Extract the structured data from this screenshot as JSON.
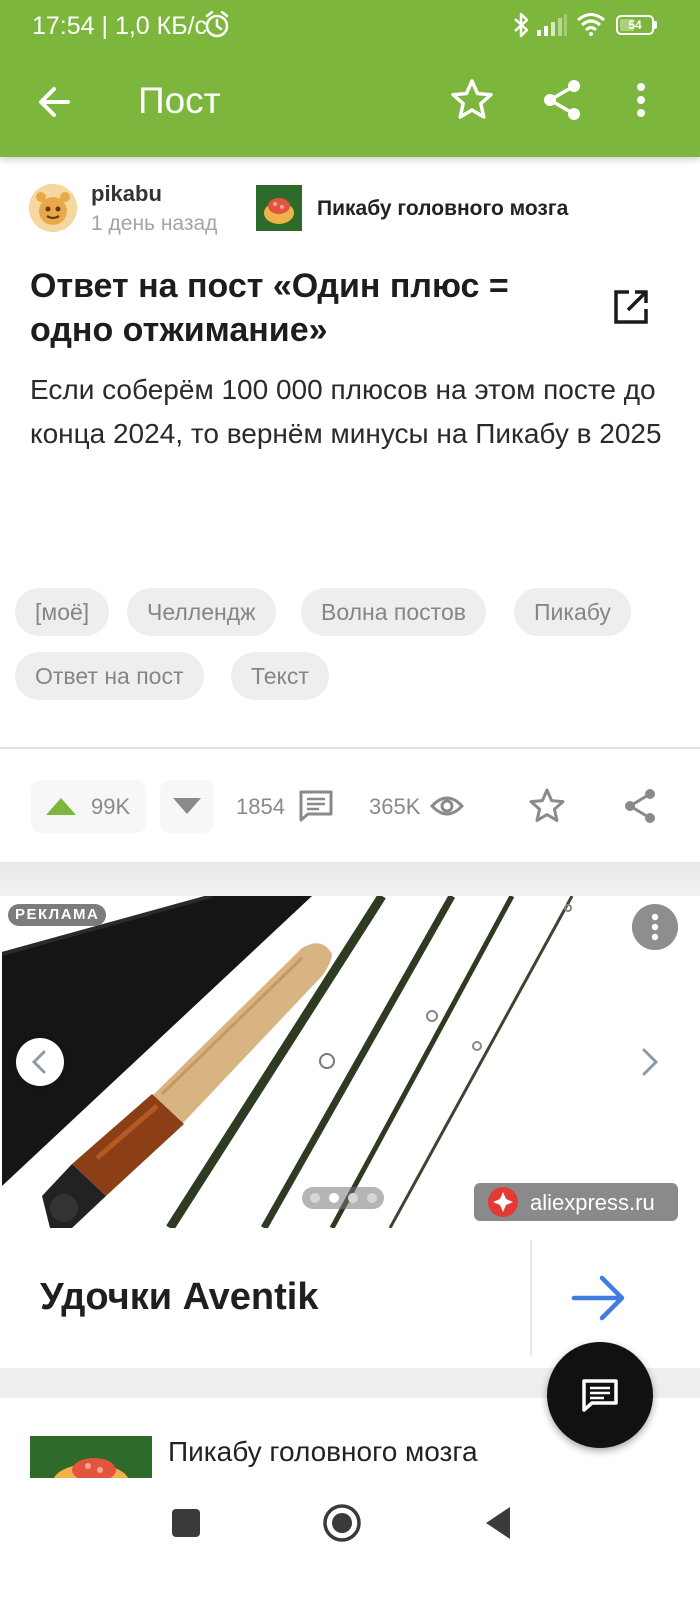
{
  "status_bar": {
    "time_speed": "17:54 | 1,0 КБ/с",
    "battery": "54",
    "icons": [
      "alarm-icon",
      "bluetooth-icon",
      "signal-icon",
      "wifi-icon",
      "battery-icon"
    ]
  },
  "toolbar": {
    "title": "Пост",
    "icons": [
      "back-arrow-icon",
      "star-icon",
      "share-icon",
      "more-vertical-icon"
    ]
  },
  "post": {
    "author": "pikabu",
    "time": "1 день назад",
    "community": "Пикабу головного мозга",
    "title": "Ответ на пост «Один плюс = одно отжимание»",
    "body": "Если соберём 100 000 плюсов на этом посте до конца 2024, то вернём минусы на Пикабу в 2025",
    "tags": [
      "[моё]",
      "Челлендж",
      "Волна постов",
      "Пикабу",
      "Ответ на пост",
      "Текст"
    ],
    "actions": {
      "upvotes": "99K",
      "comments": "1854",
      "views": "365K"
    }
  },
  "ad": {
    "badge": "РЕКЛАМА",
    "source": "aliexpress.ru",
    "title": "Удочки Aventik",
    "slides_total": 4,
    "active_slide": 2
  },
  "next_post": {
    "community": "Пикабу головного мозга"
  },
  "colors": {
    "accent": "#7db63d",
    "upvote": "#7db63d",
    "ad_arrow": "#3f7de0"
  }
}
